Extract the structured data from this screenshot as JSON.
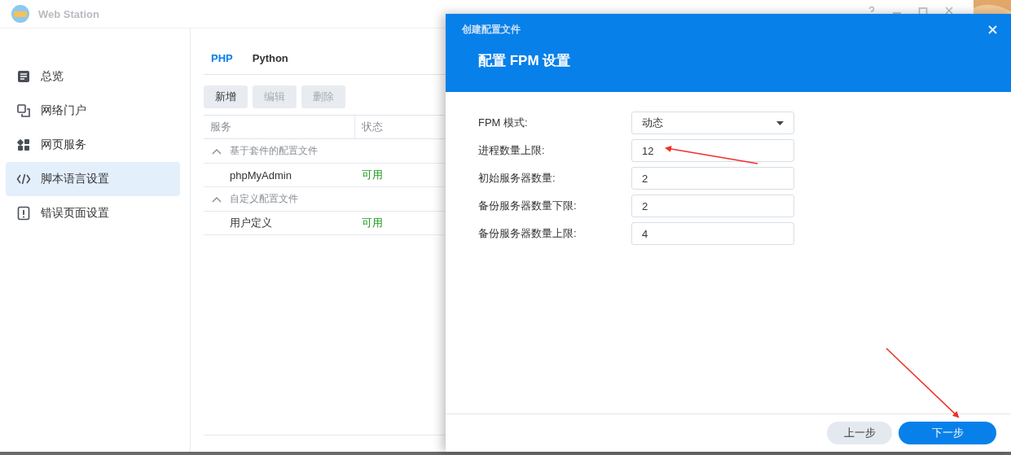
{
  "window": {
    "title": "Web Station"
  },
  "sidebar": {
    "items": [
      {
        "label": "总览",
        "kind": "document",
        "selected": false
      },
      {
        "label": "网络门户",
        "kind": "portal",
        "selected": false
      },
      {
        "label": "网页服务",
        "kind": "grid",
        "selected": false
      },
      {
        "label": "脚本语言设置",
        "kind": "code",
        "selected": true
      },
      {
        "label": "错误页面设置",
        "kind": "alert",
        "selected": false
      }
    ]
  },
  "tabs": [
    {
      "label": "PHP",
      "selected": true
    },
    {
      "label": "Python",
      "selected": false
    }
  ],
  "toolbar": {
    "buttons": [
      {
        "label": "新增",
        "disabled": false
      },
      {
        "label": "编辑",
        "disabled": true
      },
      {
        "label": "删除",
        "disabled": true
      }
    ]
  },
  "table": {
    "columns": [
      "服务",
      "状态"
    ],
    "groups": [
      {
        "label": "基于套件的配置文件",
        "expanded": true,
        "rows": [
          {
            "service": "phpMyAdmin",
            "status": "可用"
          }
        ]
      },
      {
        "label": "自定义配置文件",
        "expanded": true,
        "rows": [
          {
            "service": "用户定义",
            "status": "可用"
          }
        ]
      }
    ]
  },
  "dialog": {
    "title": "创建配置文件",
    "heading": "配置 FPM 设置",
    "fields": [
      {
        "kind": "select",
        "label": "FPM 模式:",
        "value": "动态"
      },
      {
        "kind": "input",
        "label": "进程数量上限:",
        "value": "12"
      },
      {
        "kind": "input",
        "label": "初始服务器数量:",
        "value": "2"
      },
      {
        "kind": "input",
        "label": "备份服务器数量下限:",
        "value": "2"
      },
      {
        "kind": "input",
        "label": "备份服务器数量上限:",
        "value": "4"
      }
    ],
    "buttons": [
      {
        "label": "上一步",
        "primary": false
      },
      {
        "label": "下一步",
        "primary": true
      }
    ]
  }
}
